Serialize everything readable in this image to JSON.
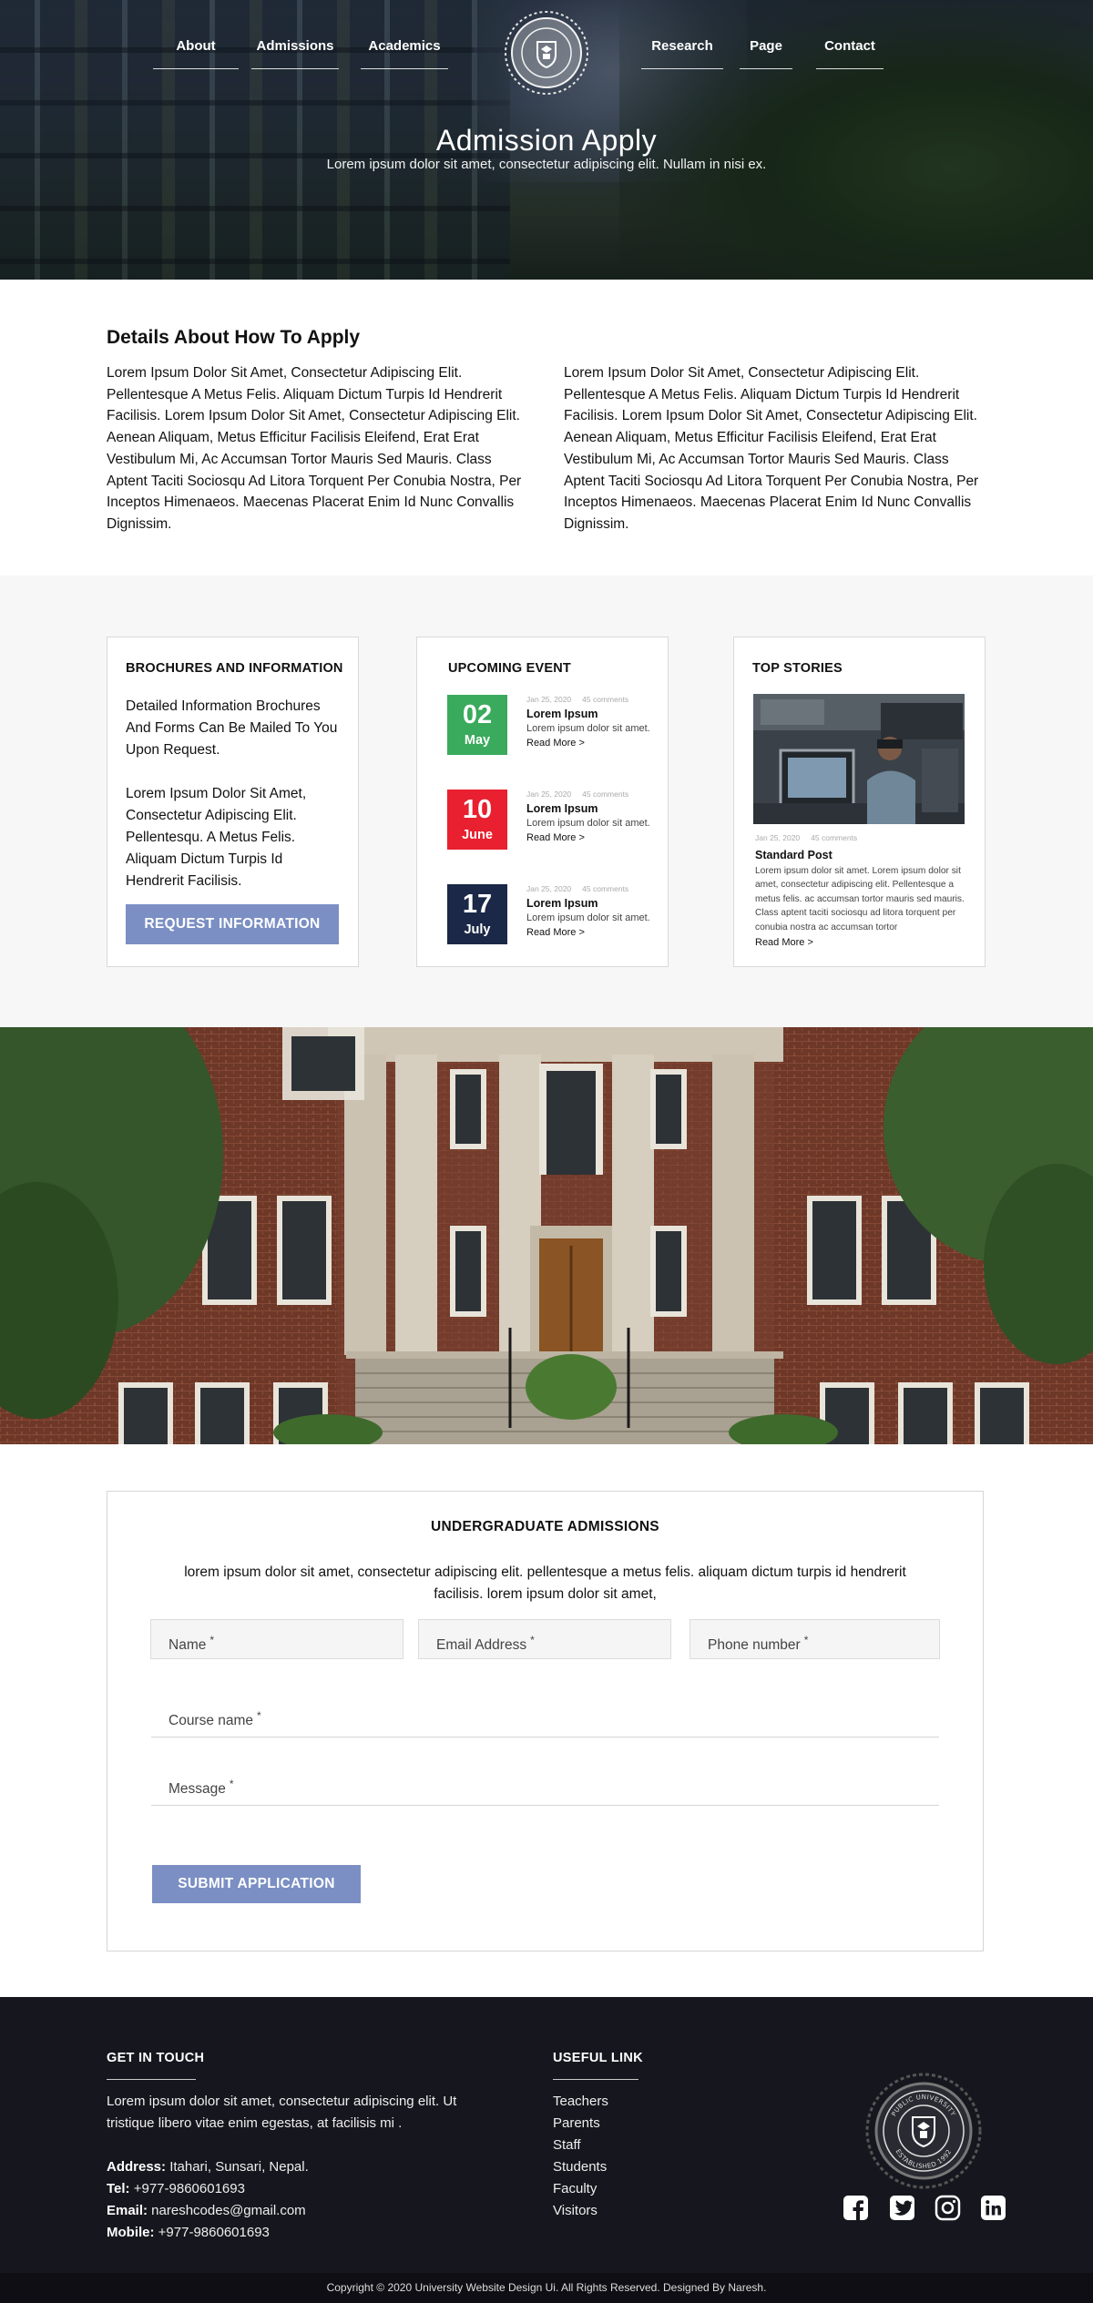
{
  "nav": {
    "left": [
      "About",
      "Admissions",
      "Academics"
    ],
    "right": [
      "Research",
      "Page",
      "Contact"
    ],
    "logo_icon": "university-seal-icon"
  },
  "hero": {
    "title": "Admission Apply",
    "subtitle": "Lorem ipsum dolor sit amet, consectetur adipiscing elit. Nullam in nisi ex."
  },
  "details": {
    "title": "Details About How To Apply",
    "col1": "Lorem Ipsum Dolor Sit Amet, Consectetur Adipiscing Elit. Pellentesque A Metus Felis. Aliquam Dictum Turpis Id Hendrerit Facilisis. Lorem Ipsum Dolor Sit Amet, Consectetur Adipiscing Elit. Aenean Aliquam, Metus Efficitur Facilisis Eleifend, Erat Erat Vestibulum Mi, Ac Accumsan Tortor Mauris Sed Mauris. Class Aptent Taciti Sociosqu Ad Litora Torquent Per Conubia Nostra, Per Inceptos Himenaeos. Maecenas Placerat Enim Id Nunc Convallis Dignissim.",
    "col2": "Lorem Ipsum Dolor Sit Amet, Consectetur Adipiscing Elit. Pellentesque A Metus Felis. Aliquam Dictum Turpis Id Hendrerit Facilisis. Lorem Ipsum Dolor Sit Amet, Consectetur Adipiscing Elit. Aenean Aliquam, Metus Efficitur Facilisis Eleifend, Erat Erat Vestibulum Mi, Ac Accumsan Tortor Mauris Sed Mauris. Class Aptent Taciti Sociosqu Ad Litora Torquent Per Conubia Nostra, Per Inceptos Himenaeos. Maecenas Placerat Enim Id Nunc Convallis Dignissim."
  },
  "brochures": {
    "title": "BROCHURES AND INFORMATION",
    "text1": "Detailed Information Brochures And Forms Can Be Mailed To You Upon Request.",
    "text2": "Lorem Ipsum Dolor Sit Amet, Consectetur Adipiscing Elit. Pellentesqu. A Metus Felis. Aliquam Dictum Turpis Id Hendrerit Facilisis.",
    "button": "REQUEST INFORMATION"
  },
  "events": {
    "title": "UPCOMING EVENT",
    "items": [
      {
        "day": "02",
        "month": "May",
        "color": "#3aaa5c",
        "date": "Jan 25, 2020",
        "comments": "45 comments",
        "name": "Lorem Ipsum",
        "desc": "Lorem ipsum dolor sit amet.",
        "more": "Read More >"
      },
      {
        "day": "10",
        "month": "June",
        "color": "#e8202f",
        "date": "Jan 25, 2020",
        "comments": "45 comments",
        "name": "Lorem Ipsum",
        "desc": "Lorem ipsum dolor sit amet.",
        "more": "Read More >"
      },
      {
        "day": "17",
        "month": "July",
        "color": "#1b2847",
        "date": "Jan 25, 2020",
        "comments": "45 comments",
        "name": "Lorem Ipsum",
        "desc": "Lorem ipsum dolor sit amet.",
        "more": "Read More >"
      }
    ]
  },
  "stories": {
    "title": "TOP STORIES",
    "date": "Jan 25, 2020",
    "comments": "45 comments",
    "name": "Standard Post",
    "desc": "Lorem ipsum dolor sit amet. Lorem ipsum dolor sit amet, consectetur adipiscing elit. Pellentesque a metus felis. ac accumsan tortor mauris sed mauris. Class aptent taciti sociosqu ad litora torquent per conubia nostra ac accumsan tortor",
    "more": "Read More >"
  },
  "form": {
    "title": "UNDERGRADUATE ADMISSIONS",
    "intro": "lorem ipsum dolor sit amet, consectetur adipiscing elit. pellentesque a metus felis. aliquam dictum turpis id hendrerit facilisis. lorem ipsum dolor sit amet,",
    "name": "Name",
    "email": "Email Address",
    "phone": "Phone number",
    "course": "Course name",
    "message": "Message",
    "required": "*",
    "submit": "SUBMIT APPLICATION"
  },
  "footer": {
    "contact_title": "GET IN TOUCH",
    "contact_text": "Lorem ipsum dolor sit amet, consectetur adipiscing elit. Ut tristique libero vitae enim egestas, at facilisis mi .",
    "address_label": "Address:",
    "address": " Itahari, Sunsari,  Nepal.",
    "tel_label": "Tel:",
    "tel": " +977-9860601693",
    "email_label": "Email:",
    "email": " nareshcodes@gmail.com",
    "mobile_label": "Mobile:",
    "mobile": " +977-9860601693",
    "links_title": "USEFUL LINK",
    "links": [
      "Teachers",
      "Parents",
      "Staff",
      "Students",
      "Faculty",
      "Visitors"
    ],
    "logo_icon": "university-seal-icon",
    "seal_top": "PUBLIC UNIVERSITY",
    "seal_bottom": "ESTABLISHED 1992",
    "social": [
      "facebook-icon",
      "twitter-icon",
      "instagram-icon",
      "linkedin-icon"
    ],
    "copyright": "Copyright © 2020 University Website Design Ui. All Rights Reserved. Designed By Naresh."
  }
}
